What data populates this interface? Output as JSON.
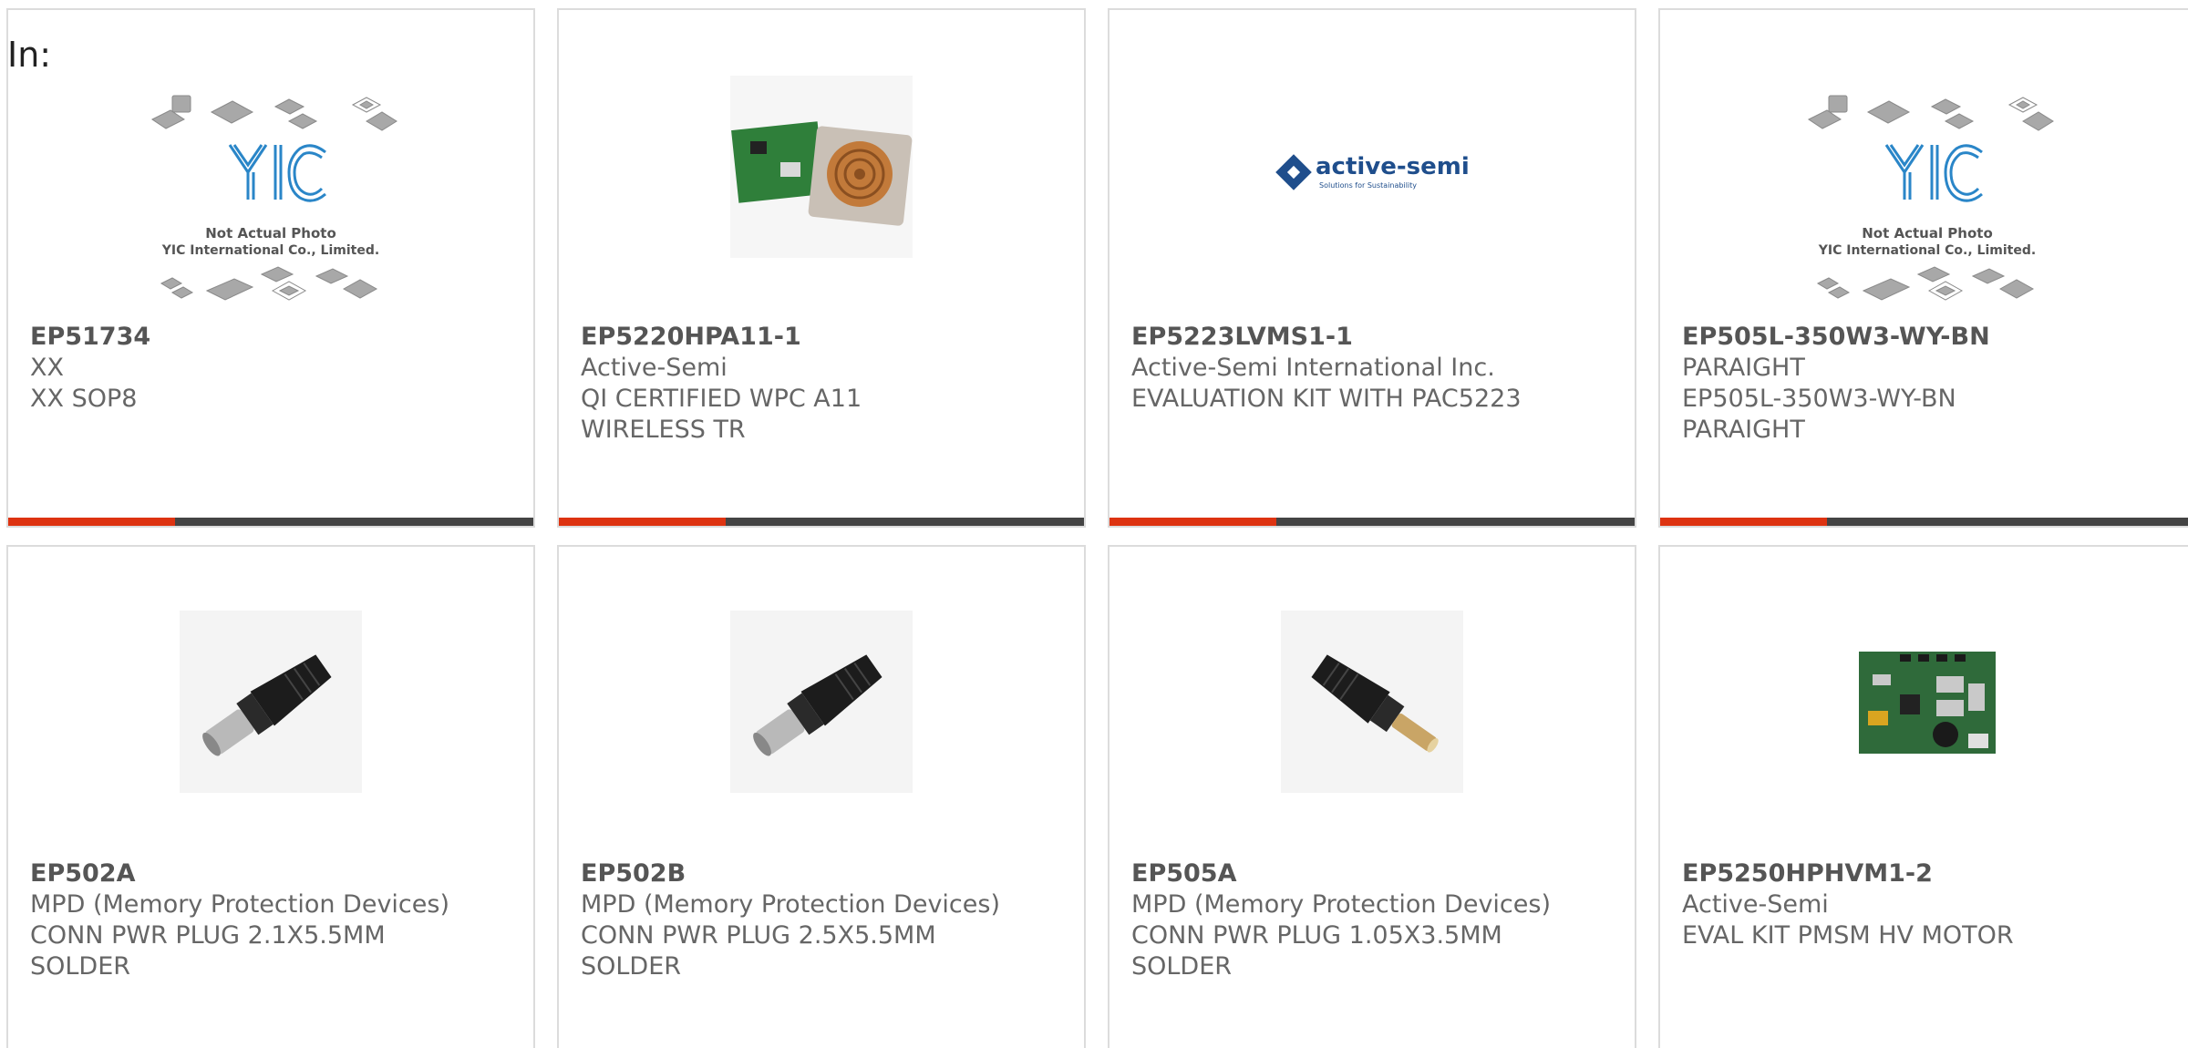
{
  "filter_label": "In:",
  "colors": {
    "accent": "#dd3311",
    "bar": "#444444",
    "border": "#dcdcdc"
  },
  "products": [
    {
      "part": "EP51734",
      "lines": [
        "XX",
        "XX SOP8"
      ],
      "image": "placeholder-icon",
      "placeholder": {
        "line1": "Not Actual Photo",
        "line2": "YIC International Co., Limited."
      }
    },
    {
      "part": "EP5220HPA11-1",
      "lines": [
        "Active-Semi",
        "QI CERTIFIED WPC A11",
        "WIRELESS TR"
      ],
      "image": "wireless-board-icon"
    },
    {
      "part": "EP5223LVMS1-1",
      "lines": [
        "Active-Semi International Inc.",
        "EVALUATION KIT WITH PAC5223"
      ],
      "image": "active-semi-logo",
      "logo": {
        "name": "active-semi",
        "tagline": "Solutions for Sustainability"
      }
    },
    {
      "part": "EP505L-350W3-WY-BN",
      "lines": [
        "PARAIGHT",
        "EP505L-350W3-WY-BN",
        "PARAIGHT"
      ],
      "image": "placeholder-icon",
      "placeholder": {
        "line1": "Not Actual Photo",
        "line2": "YIC International Co., Limited."
      }
    },
    {
      "part": "EP502A",
      "lines": [
        "MPD (Memory Protection Devices)",
        "CONN PWR PLUG 2.1X5.5MM",
        "SOLDER"
      ],
      "image": "power-plug-icon"
    },
    {
      "part": "EP502B",
      "lines": [
        "MPD (Memory Protection Devices)",
        "CONN PWR PLUG 2.5X5.5MM",
        "SOLDER"
      ],
      "image": "power-plug-icon"
    },
    {
      "part": "EP505A",
      "lines": [
        "MPD (Memory Protection Devices)",
        "CONN PWR PLUG 1.05X3.5MM",
        "SOLDER"
      ],
      "image": "power-plug-icon"
    },
    {
      "part": "EP5250HPHVM1-2",
      "lines": [
        "Active-Semi",
        "EVAL KIT PMSM HV MOTOR"
      ],
      "image": "motor-board-icon"
    }
  ]
}
